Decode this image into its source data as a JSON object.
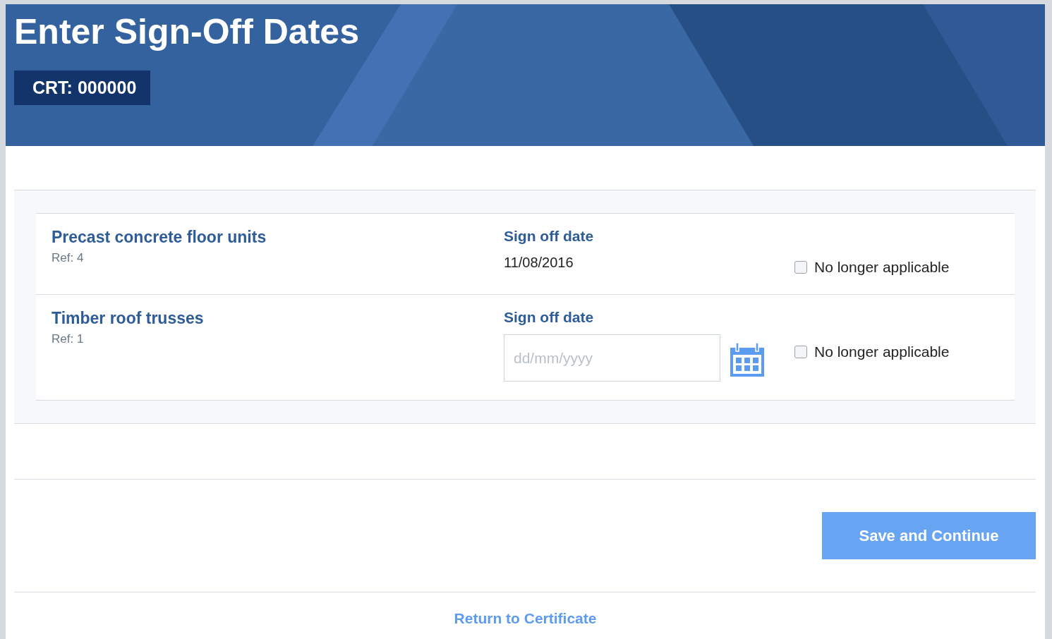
{
  "header": {
    "title": "Enter Sign-Off Dates",
    "badge": "CRT: 000000"
  },
  "items": [
    {
      "name": "Precast concrete floor units",
      "ref": "Ref: 4",
      "date_label": "Sign off date",
      "kind": "text",
      "date": "11/08/2016",
      "option": {
        "label": "No longer applicable",
        "checked": false
      }
    },
    {
      "name": "Timber roof trusses",
      "ref": "Ref: 1",
      "date_label": "Sign off date",
      "kind": "input",
      "placeholder": "dd/mm/yyyy",
      "option": {
        "label": "No longer applicable",
        "checked": false
      }
    }
  ],
  "save_button": "Save and Continue",
  "return_link": "Return to Certificate"
}
